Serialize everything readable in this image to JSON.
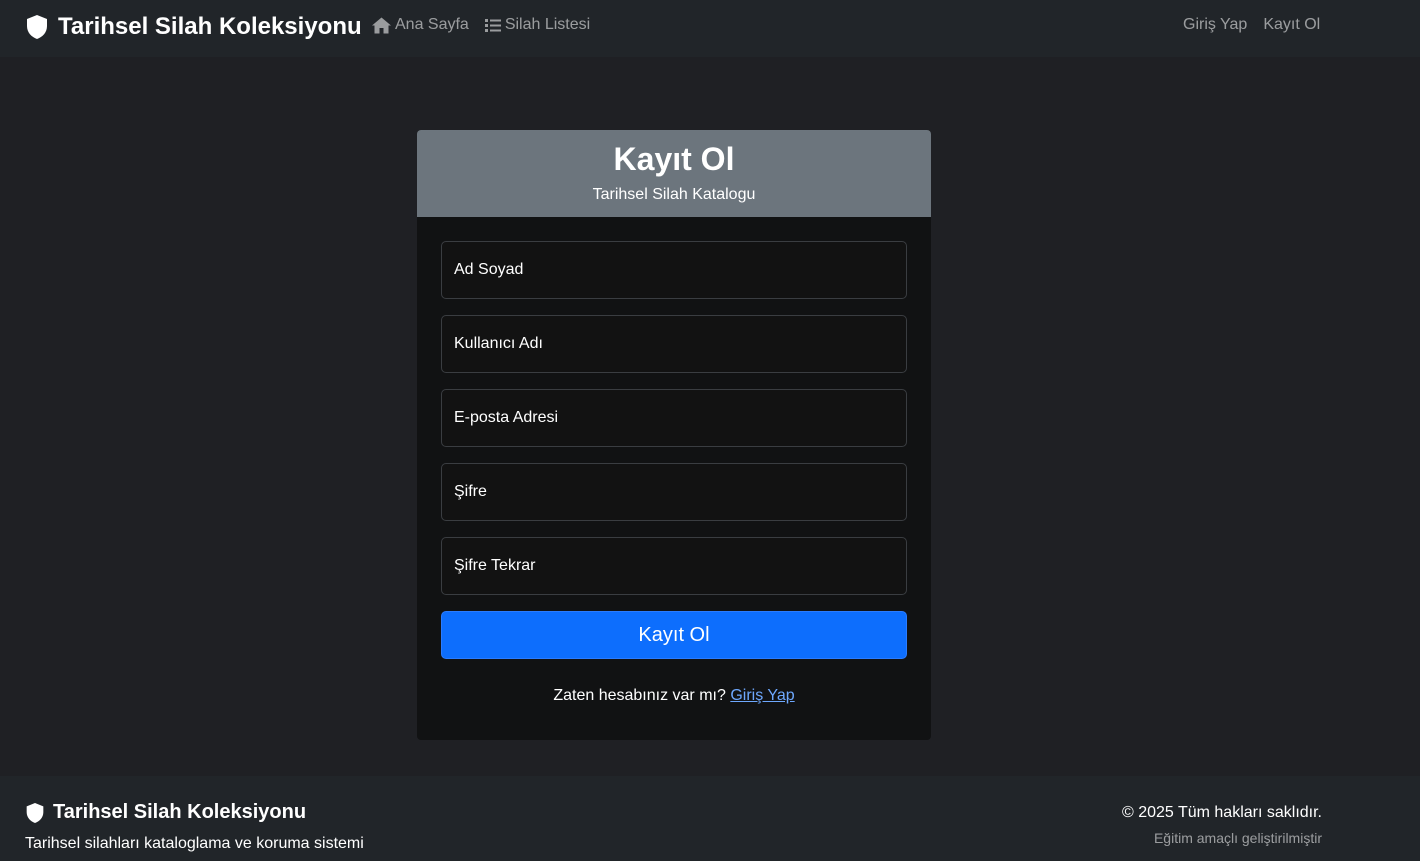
{
  "navbar": {
    "brand": "Tarihsel Silah Koleksiyonu",
    "links": [
      {
        "label": "Ana Sayfa",
        "icon": "home-icon"
      },
      {
        "label": "Silah Listesi",
        "icon": "list-icon"
      }
    ],
    "right_links": [
      {
        "label": "Giriş Yap"
      },
      {
        "label": "Kayıt Ol"
      }
    ]
  },
  "form": {
    "title": "Kayıt Ol",
    "subtitle": "Tarihsel Silah Katalogu",
    "fields": [
      {
        "label": "Ad Soyad"
      },
      {
        "label": "Kullanıcı Adı"
      },
      {
        "label": "E-posta Adresi"
      },
      {
        "label": "Şifre"
      },
      {
        "label": "Şifre Tekrar"
      }
    ],
    "submit_label": "Kayıt Ol",
    "switch_prompt": "Zaten hesabınız var mı?",
    "switch_link": "Giriş Yap"
  },
  "footer": {
    "brand": "Tarihsel Silah Koleksiyonu",
    "description": "Tarihsel silahları kataloglama ve koruma sistemi",
    "copyright": "© 2025 Tüm hakları saklıdır.",
    "note": "Eğitim amaçlı geliştirilmiştir"
  },
  "colors": {
    "page_bg": "#1f2024",
    "navbar_bg": "#212529",
    "card_header_bg": "#6c757d",
    "primary": "#0d6efd",
    "link": "#6ea8fe"
  }
}
